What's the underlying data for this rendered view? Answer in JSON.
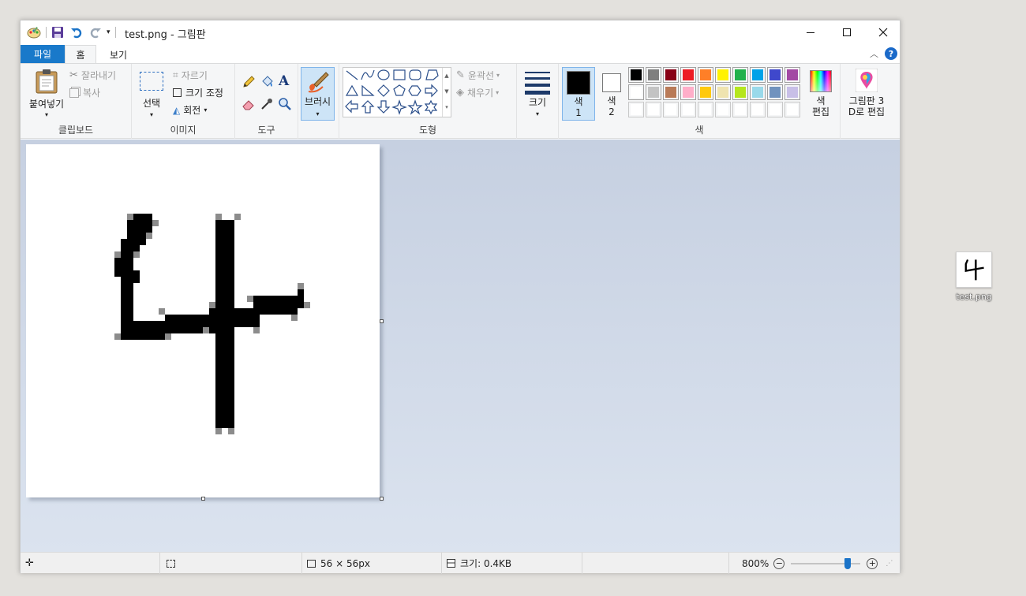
{
  "window": {
    "title": "test.png - 그림판"
  },
  "tabs": {
    "file": "파일",
    "home": "홈",
    "view": "보기"
  },
  "clipboard": {
    "paste": "붙여넣기",
    "cut": "잘라내기",
    "copy": "복사",
    "label": "클립보드"
  },
  "image": {
    "select": "선택",
    "crop": "자르기",
    "resize": "크기 조정",
    "rotate": "회전",
    "label": "이미지"
  },
  "tools": {
    "label": "도구"
  },
  "brushes": {
    "label": "브러시"
  },
  "shapes": {
    "outline": "윤곽선",
    "fill": "채우기",
    "label": "도형"
  },
  "size": {
    "label": "크기"
  },
  "colors": {
    "color1": "색\n1",
    "color2": "색\n2",
    "color1_value": "#000000",
    "color2_value": "#ffffff",
    "edit": "색\n편집",
    "label": "색",
    "palette_row1": [
      "#000000",
      "#7f7f7f",
      "#880015",
      "#ed1c24",
      "#ff7f27",
      "#fff200",
      "#22b14c",
      "#00a2e8",
      "#3f48cc",
      "#a349a4"
    ],
    "palette_row2": [
      "#ffffff",
      "#c3c3c3",
      "#b97a57",
      "#ffaec9",
      "#ffc90e",
      "#efe4b0",
      "#b5e61d",
      "#99d9ea",
      "#7092be",
      "#c8bfe7"
    ],
    "palette_row3": [
      "#ffffff",
      "#ffffff",
      "#ffffff",
      "#ffffff",
      "#ffffff",
      "#ffffff",
      "#ffffff",
      "#ffffff",
      "#ffffff",
      "#ffffff"
    ]
  },
  "paint3d": {
    "label": "그림판 3\nD로 편집"
  },
  "status": {
    "dimensions": "56 × 56px",
    "filesize": "크기: 0.4KB",
    "zoom": "800%",
    "zoom_fraction": 0.82
  },
  "desktop": {
    "icon_label": "test.png"
  }
}
